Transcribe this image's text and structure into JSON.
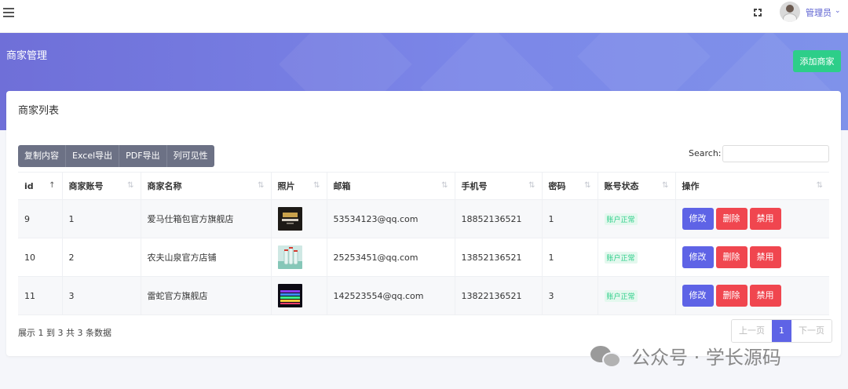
{
  "topbar": {
    "user_name": "管理员",
    "caret": "⌄"
  },
  "header": {
    "title": "商家管理",
    "add_button": "添加商家"
  },
  "card": {
    "title": "商家列表",
    "toolbar": [
      "复制内容",
      "Excel导出",
      "PDF导出",
      "列可见性"
    ],
    "search_label": "Search:",
    "search_value": ""
  },
  "table": {
    "columns": [
      "id",
      "商家账号",
      "商家名称",
      "照片",
      "邮箱",
      "手机号",
      "密码",
      "账号状态",
      "操作"
    ],
    "rows": [
      {
        "id": "9",
        "account": "1",
        "name": "爱马仕箱包官方旗舰店",
        "photo": "hermes-logo",
        "email": "53534123@qq.com",
        "phone": "18852136521",
        "password": "1",
        "status": "账户正常"
      },
      {
        "id": "10",
        "account": "2",
        "name": "农夫山泉官方店铺",
        "photo": "water-bottles",
        "email": "25253451@qq.com",
        "phone": "13852136521",
        "password": "1",
        "status": "账户正常"
      },
      {
        "id": "11",
        "account": "3",
        "name": "雷蛇官方旗舰店",
        "photo": "rgb-keyboard",
        "email": "142523554@qq.com",
        "phone": "13822136521",
        "password": "3",
        "status": "账户正常"
      }
    ],
    "actions": {
      "edit": "修改",
      "delete": "删除",
      "ban": "禁用"
    }
  },
  "footer": {
    "info": "展示 1 到 3 共 3 条数据",
    "prev": "上一页",
    "page": "1",
    "next": "下一页"
  },
  "watermark": "公众号 · 学长源码",
  "colors": {
    "brand": "#5e63e6",
    "success": "#2dce89",
    "danger": "#f0464f",
    "band": "#7b86e8"
  }
}
